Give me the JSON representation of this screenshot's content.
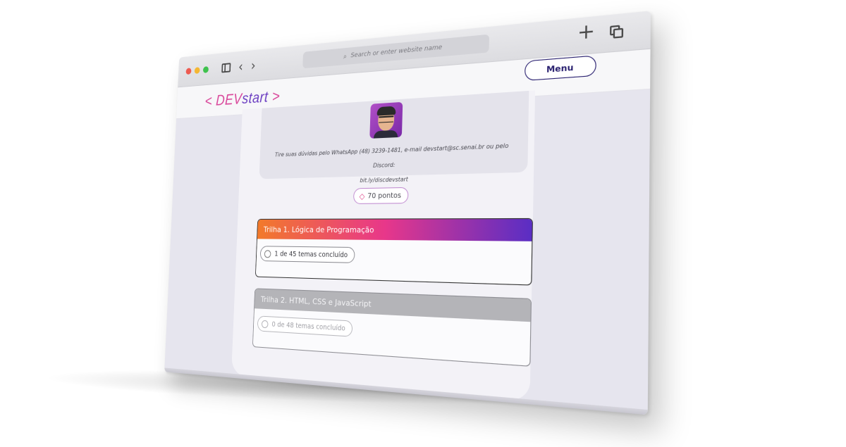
{
  "browser": {
    "address_placeholder": "Search or enter website name"
  },
  "site": {
    "logo_left": "<",
    "logo_dev": "DEV",
    "logo_start": "start",
    "logo_right": ">",
    "menu_label": "Menu"
  },
  "contact": {
    "line1": "Tire suas dúvidas pelo WhatsApp (48) 3239-1481, e-mail devstart@sc.senai.br ou pelo Discord:",
    "line2": "bit.ly/discdevstart"
  },
  "points": {
    "label": "70 pontos",
    "icon": "gem-icon"
  },
  "tracks": [
    {
      "title": "Trilha 1. Lógica de Programação",
      "progress": "1 de 45 temas concluído"
    },
    {
      "title": "Trilha 2. HTML, CSS e JavaScript",
      "progress": "0 de 48 temas concluído"
    }
  ],
  "colors": {
    "accent_pink": "#e8378a",
    "accent_orange": "#f27a2a",
    "accent_purple": "#5a2ec4",
    "menu_border": "#2a2170"
  }
}
